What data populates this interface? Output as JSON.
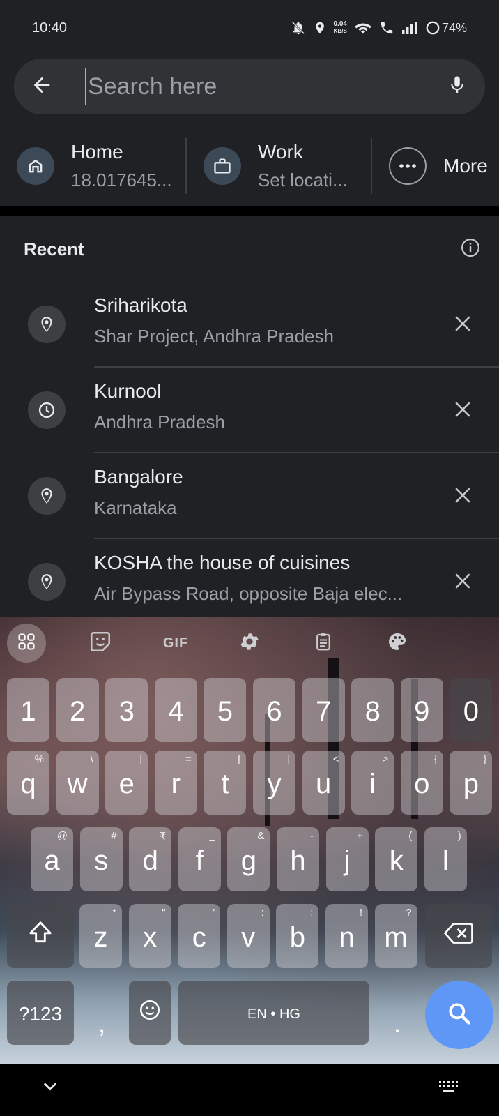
{
  "status": {
    "time": "10:40",
    "speed_value": "0.04",
    "speed_unit": "KB/S",
    "battery": "74%"
  },
  "search": {
    "placeholder": "Search here"
  },
  "shortcuts": [
    {
      "icon": "home-icon",
      "title": "Home",
      "subtitle": "18.017645..."
    },
    {
      "icon": "briefcase-icon",
      "title": "Work",
      "subtitle": "Set locati..."
    },
    {
      "icon": "more-icon",
      "title": "More"
    }
  ],
  "recent": {
    "title": "Recent",
    "items": [
      {
        "icon": "place-pin-icon",
        "title": "Sriharikota",
        "subtitle": "Shar Project, Andhra Pradesh"
      },
      {
        "icon": "history-clock-icon",
        "title": "Kurnool",
        "subtitle": "Andhra Pradesh"
      },
      {
        "icon": "place-pin-icon",
        "title": "Bangalore",
        "subtitle": "Karnataka"
      },
      {
        "icon": "place-pin-icon",
        "title": "KOSHA the house of cuisines",
        "subtitle": "Air Bypass Road, opposite Baja elec..."
      }
    ]
  },
  "keyboard": {
    "toolbar_gif": "GIF",
    "numbers": [
      "1",
      "2",
      "3",
      "4",
      "5",
      "6",
      "7",
      "8",
      "9",
      "0"
    ],
    "row1": [
      {
        "k": "q",
        "h": "%"
      },
      {
        "k": "w",
        "h": "\\"
      },
      {
        "k": "e",
        "h": "|"
      },
      {
        "k": "r",
        "h": "="
      },
      {
        "k": "t",
        "h": "["
      },
      {
        "k": "y",
        "h": "]"
      },
      {
        "k": "u",
        "h": "<"
      },
      {
        "k": "i",
        "h": ">"
      },
      {
        "k": "o",
        "h": "{"
      },
      {
        "k": "p",
        "h": "}"
      }
    ],
    "row2": [
      {
        "k": "a",
        "h": "@"
      },
      {
        "k": "s",
        "h": "#"
      },
      {
        "k": "d",
        "h": "₹"
      },
      {
        "k": "f",
        "h": "_"
      },
      {
        "k": "g",
        "h": "&"
      },
      {
        "k": "h",
        "h": "-"
      },
      {
        "k": "j",
        "h": "+"
      },
      {
        "k": "k",
        "h": "("
      },
      {
        "k": "l",
        "h": ")"
      }
    ],
    "row3": [
      {
        "k": "z",
        "h": "*"
      },
      {
        "k": "x",
        "h": "\""
      },
      {
        "k": "c",
        "h": "'"
      },
      {
        "k": "v",
        "h": ":"
      },
      {
        "k": "b",
        "h": ";"
      },
      {
        "k": "n",
        "h": "!"
      },
      {
        "k": "m",
        "h": "?"
      }
    ],
    "symbols_label": "?123",
    "comma": ",",
    "space_label": "EN • HG",
    "period": "."
  },
  "colors": {
    "background": "#1f2124",
    "search_bar": "#303236",
    "accent": "#8ab4f8",
    "fab": "#5e97f6"
  }
}
